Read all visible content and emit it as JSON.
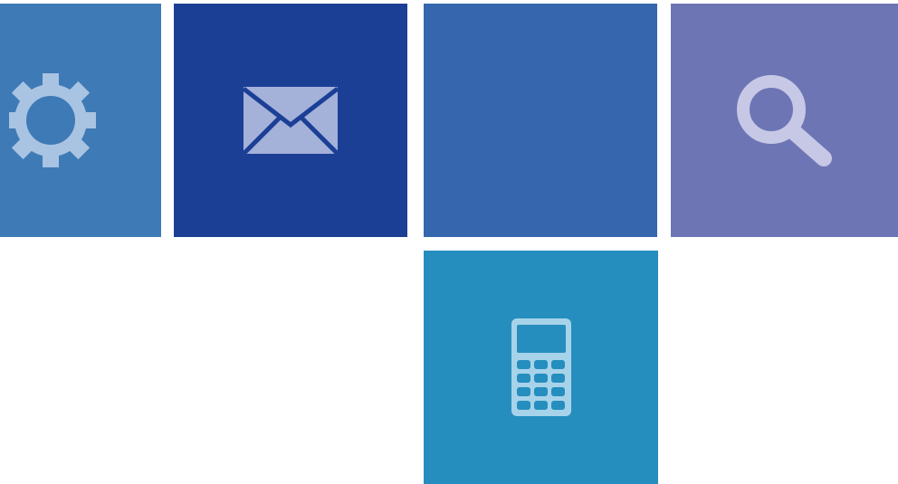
{
  "tiles": [
    {
      "id": "settings",
      "icon": "gear-icon",
      "bg": "#3e7ab5",
      "icon_color": "#a9c3e3"
    },
    {
      "id": "mail",
      "icon": "envelope-icon",
      "bg": "#1c3f96",
      "icon_color": "#a4b1d9"
    },
    {
      "id": "blank",
      "icon": "",
      "bg": "#3566ae",
      "icon_color": ""
    },
    {
      "id": "search",
      "icon": "search-icon",
      "bg": "#6e75b4",
      "icon_color": "#c6c8e6"
    },
    {
      "id": "calculator",
      "icon": "calculator-icon",
      "bg": "#258ebe",
      "icon_color": "#a7d3ea"
    }
  ]
}
